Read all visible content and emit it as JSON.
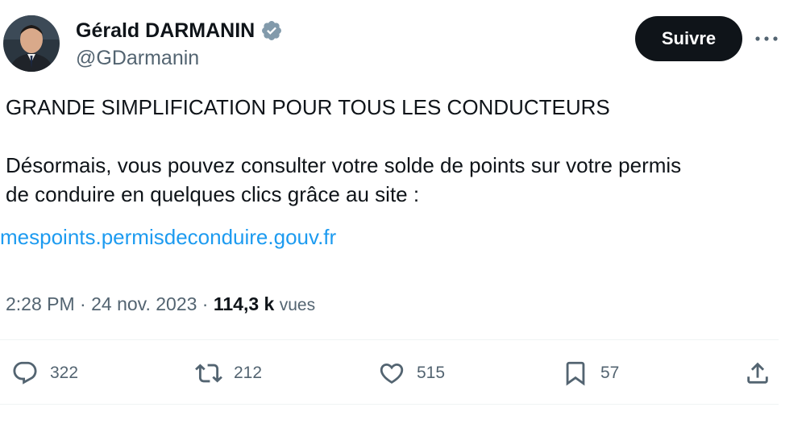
{
  "author": {
    "display_name": "Gérald DARMANIN",
    "handle": "@GDarmanin",
    "verified": true,
    "avatar": "avatar-photo"
  },
  "header": {
    "follow_label": "Suivre",
    "more_icon": "more-horizontal-icon"
  },
  "tweet": {
    "text": "GRANDE SIMPLIFICATION POUR TOUS LES CONDUCTEURS\n\nDésormais, vous pouvez consulter votre solde de points sur votre permis\nde conduire en quelques clics grâce au site :",
    "link": "mespoints.permisdeconduire.gouv.fr"
  },
  "meta": {
    "time": "2:28 PM",
    "separator": "·",
    "date": "24 nov. 2023",
    "views_count": "114,3 k",
    "views_label": "vues"
  },
  "actions": {
    "replies": {
      "icon": "reply-icon",
      "count": "322"
    },
    "reposts": {
      "icon": "repost-icon",
      "count": "212"
    },
    "likes": {
      "icon": "like-icon",
      "count": "515"
    },
    "bookmarks": {
      "icon": "bookmark-icon",
      "count": "57"
    },
    "share": {
      "icon": "share-icon"
    }
  },
  "colors": {
    "text": "#0f1419",
    "secondary": "#536471",
    "link": "#1d9bf0",
    "verified_badge": "#829aab",
    "button_bg": "#0f1419",
    "divider": "#eff3f4"
  }
}
